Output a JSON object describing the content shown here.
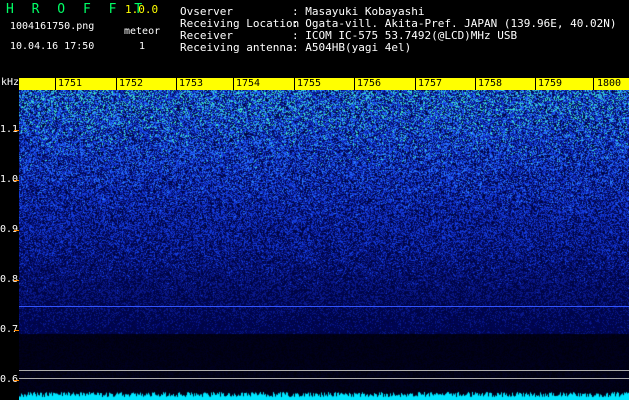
{
  "header": {
    "app_title": "H R O F F T",
    "version": "1.0.0",
    "filename": "1004161750.png",
    "mode": "meteor",
    "datetime": "10.04.16 17:50",
    "count": "1"
  },
  "info": {
    "observer_label": "Ovserver",
    "observer_value": ": Masayuki Kobayashi",
    "location_label": "Receiving Location",
    "location_value": ": Ogata-vill. Akita-Pref. JAPAN (139.96E, 40.02N)",
    "receiver_label": "Receiver",
    "receiver_value": ": ICOM IC-575 53.7492(@LCD)MHz USB",
    "antenna_label": "Receiving antenna",
    "antenna_value": ": A504HB(yagi 4el)"
  },
  "plot": {
    "y_unit": "kHz",
    "y_labels": [
      "1.1",
      "1.0",
      "0.9",
      "0.8",
      "0.7",
      "0.6"
    ],
    "time_ticks": [
      "1751",
      "1752",
      "1753",
      "1754",
      "1755",
      "1756",
      "1757",
      "1758",
      "1759",
      "1800"
    ],
    "colors": {
      "tick_bar": "#ffff00",
      "line": "#3355ff",
      "cyan": "#00ffff",
      "axis_tick": "#ff8800"
    }
  }
}
